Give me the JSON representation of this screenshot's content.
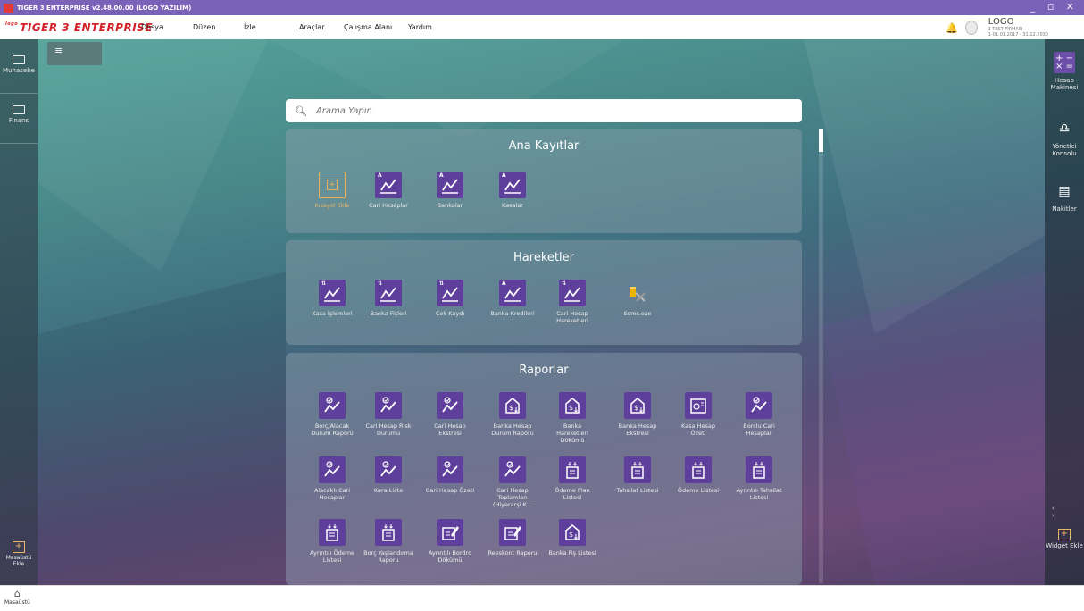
{
  "window": {
    "title": "TIGER 3 ENTERPRISE v2.48.00.00 (LOGO YAZILIM)",
    "controls": "_ ▫ ✕"
  },
  "app": {
    "logo_prefix": "logo",
    "logo": "TIGER 3 ENTERPRISE"
  },
  "menu": [
    "Dosya",
    "Düzen",
    "İzle",
    "Araçlar",
    "Çalışma Alanı",
    "Yardım"
  ],
  "company": {
    "name": "LOGO",
    "firm": "1-TEST FİRMASI",
    "period": "1-01.01.2017 - 31.12.2030"
  },
  "left_sidebar": [
    {
      "label": "Muhasebe",
      "icon": "monitor-icon"
    },
    {
      "label": "Finans",
      "icon": "monitor-icon"
    }
  ],
  "left_bottom": {
    "label": "Masaüstü Ekle",
    "icon": "add-icon"
  },
  "right_sidebar": [
    {
      "label": "Hesap Makinesi",
      "icon": "calculator-icon"
    },
    {
      "label": "Yönetici Konsolu",
      "icon": "admin-console-icon"
    },
    {
      "label": "Nakitler",
      "icon": "cash-icon"
    }
  ],
  "right_bottom": {
    "label": "Widget Ekle",
    "icon": "add-icon",
    "arrows": "‹ ›"
  },
  "search": {
    "placeholder": "Arama Yapın"
  },
  "sections": [
    {
      "title": "Ana Kayıtlar",
      "tiles": [
        {
          "label": "Kısayol Ekle",
          "type": "add"
        },
        {
          "label": "Cari Hesaplar",
          "type": "chart",
          "badge": "A"
        },
        {
          "label": "Bankalar",
          "type": "chart",
          "badge": "A"
        },
        {
          "label": "Kasalar",
          "type": "chart",
          "badge": "A"
        }
      ]
    },
    {
      "title": "Hareketler",
      "tiles": [
        {
          "label": "Kasa İşlemleri",
          "type": "chart",
          "badge": "⇅"
        },
        {
          "label": "Banka Fişleri",
          "type": "chart",
          "badge": "⇅"
        },
        {
          "label": "Çek Kaydı",
          "type": "chart",
          "badge": "⇅"
        },
        {
          "label": "Banka Kredileri",
          "type": "chart",
          "badge": "A"
        },
        {
          "label": "Cari Hesap Hareketleri",
          "type": "chart",
          "badge": "⇅"
        },
        {
          "label": "Ssms.exe",
          "type": "exe"
        }
      ]
    },
    {
      "title": "Raporlar",
      "tiles": [
        {
          "label": "Borç/Alacak Durum Raporu",
          "type": "report-chart"
        },
        {
          "label": "Cari Hesap Risk Durumu",
          "type": "report-chart"
        },
        {
          "label": "Cari Hesap Ekstresi",
          "type": "report-chart"
        },
        {
          "label": "Banka Hesap Durum Raporu",
          "type": "bank"
        },
        {
          "label": "Banka Hareketleri Dökümü",
          "type": "bank"
        },
        {
          "label": "Banka Hesap Ekstresi",
          "type": "bank"
        },
        {
          "label": "Kasa Hesap Özeti",
          "type": "safe"
        },
        {
          "label": "Borçlu Cari Hesaplar",
          "type": "report-chart"
        },
        {
          "label": "Alacaklı Cari Hesaplar",
          "type": "report-chart"
        },
        {
          "label": "Kara Liste",
          "type": "report-chart"
        },
        {
          "label": "Cari Hesap Özeti",
          "type": "report-chart"
        },
        {
          "label": "Cari Hesap Toplamları (Hiyerarşi K...",
          "type": "report-chart"
        },
        {
          "label": "Ödeme Plan Listesi",
          "type": "doc"
        },
        {
          "label": "Tahsilat Listesi",
          "type": "doc"
        },
        {
          "label": "Ödeme Listesi",
          "type": "doc"
        },
        {
          "label": "Ayrıntılı Tahsilat Listesi",
          "type": "doc"
        },
        {
          "label": "Ayrıntılı Ödeme Listesi",
          "type": "doc"
        },
        {
          "label": "Borç Yaşlandırma Raporu",
          "type": "doc"
        },
        {
          "label": "Ayrıntılı Bordro Dökümü",
          "type": "pen"
        },
        {
          "label": "Reeskont Raporu",
          "type": "pen"
        },
        {
          "label": "Banka Fiş Listesi",
          "type": "bank"
        }
      ]
    }
  ],
  "taskbar": {
    "home_label": "Masaüstü",
    "icon": "home-icon"
  }
}
